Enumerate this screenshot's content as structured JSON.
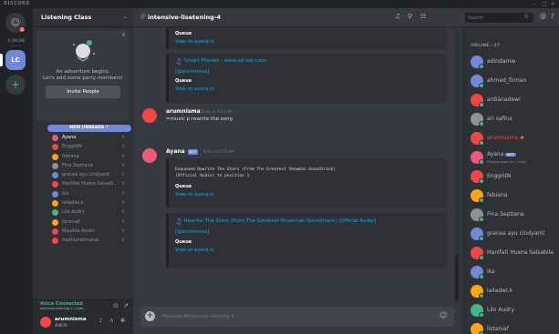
{
  "app": {
    "brand": "DISCORD",
    "window_controls": [
      "–",
      "□",
      "✕"
    ]
  },
  "guilds": {
    "home_badge": "3",
    "online_label": "0 ONLINE",
    "active_server_initials": "LC",
    "add_label": "+"
  },
  "server": {
    "name": "Listening Class",
    "invite": {
      "line1": "An adventure begins.",
      "line2": "Let's add some party members!",
      "button": "Invite People"
    },
    "new_unreads": "NEW UNREADS ↑",
    "channel_members": [
      {
        "name": "Ayana",
        "color": "#e85c7a",
        "active": true
      },
      {
        "name": "EnggritN",
        "color": "#f04747"
      },
      {
        "name": "febiana",
        "color": "#faa61a"
      },
      {
        "name": "Fina Septiana",
        "color": "#8e9297"
      },
      {
        "name": "gracea ayu cindyanti",
        "color": "#7289da"
      },
      {
        "name": "Hanifati Husna Salsabi...",
        "color": "#f04747"
      },
      {
        "name": "ika",
        "color": "#7289da"
      },
      {
        "name": "lailadwi.k",
        "color": "#faa61a"
      },
      {
        "name": "Lilo Audry",
        "color": "#43b581"
      },
      {
        "name": "listaniaf",
        "color": "#faa61a"
      },
      {
        "name": "Maulida Anum",
        "color": "#f04747"
      },
      {
        "name": "muthiarahmana",
        "color": "#f04747"
      }
    ]
  },
  "voice": {
    "title": "Voice Connected",
    "subtitle": "intensive-listening-1 / Liste..."
  },
  "user": {
    "name": "arumnisma",
    "discriminator": "#4676"
  },
  "channel": {
    "name": "intensive-lisetening-4"
  },
  "messages": {
    "embed1": {
      "queue": "Queue",
      "view": "View on ayana.io"
    },
    "embed2": {
      "title": "Smart Phones - www.ad-lab.com",
      "requester": "[@arumnisma]",
      "queue": "Queue",
      "view": "View on ayana.io"
    },
    "msg1": {
      "author": "arumnisma",
      "time": "Today at 9:24 AM",
      "text": "=music p rewrite the song"
    },
    "msg2": {
      "author": "Ayana",
      "bot_tag": "BOT",
      "time": "Today at 9:25 AM",
      "enqueued1": "Enqueued Rewrite The Stars (From The Greatest Showman Soundtrack)",
      "enqueued2": "[Official Audio] to position 1",
      "queue": "Queue",
      "view": "View on ayana.io",
      "track_title": "Rewrite The Stars (From The Greatest Showman Soundtrack) [Official Audio]",
      "requester": "[@arumnisma]",
      "queue2": "Queue",
      "view2": "View on ayana.io"
    }
  },
  "composer": {
    "placeholder": "Message #intensive-listening-4"
  },
  "members_panel": {
    "search_placeholder": "Search",
    "online_header": "ONLINE—27",
    "members": [
      {
        "name": "adindamw",
        "color": "#7289da"
      },
      {
        "name": "ahmed_firman",
        "color": "#7289da"
      },
      {
        "name": "ardianadewi",
        "color": "#f04747"
      },
      {
        "name": "ari safina",
        "color": "#8e9297"
      },
      {
        "name": "arumnisma",
        "color": "#f04747",
        "highlight": true,
        "suffix": "★"
      },
      {
        "name": "Ayana",
        "color": "#e85c7a",
        "bot": "BOT",
        "sub": "Playing ayana.io | =help"
      },
      {
        "name": "EnggritN",
        "color": "#f04747"
      },
      {
        "name": "febiana",
        "color": "#faa61a"
      },
      {
        "name": "Fina Septiana",
        "color": "#8e9297"
      },
      {
        "name": "gracea ayu cindyanti",
        "color": "#7289da"
      },
      {
        "name": "Hanifati Husna Salsabila",
        "color": "#f04747"
      },
      {
        "name": "ika",
        "color": "#7289da"
      },
      {
        "name": "lailadwi.k",
        "color": "#faa61a"
      },
      {
        "name": "Lilo Audry",
        "color": "#43b581"
      },
      {
        "name": "listaniaf",
        "color": "#faa61a"
      }
    ]
  }
}
